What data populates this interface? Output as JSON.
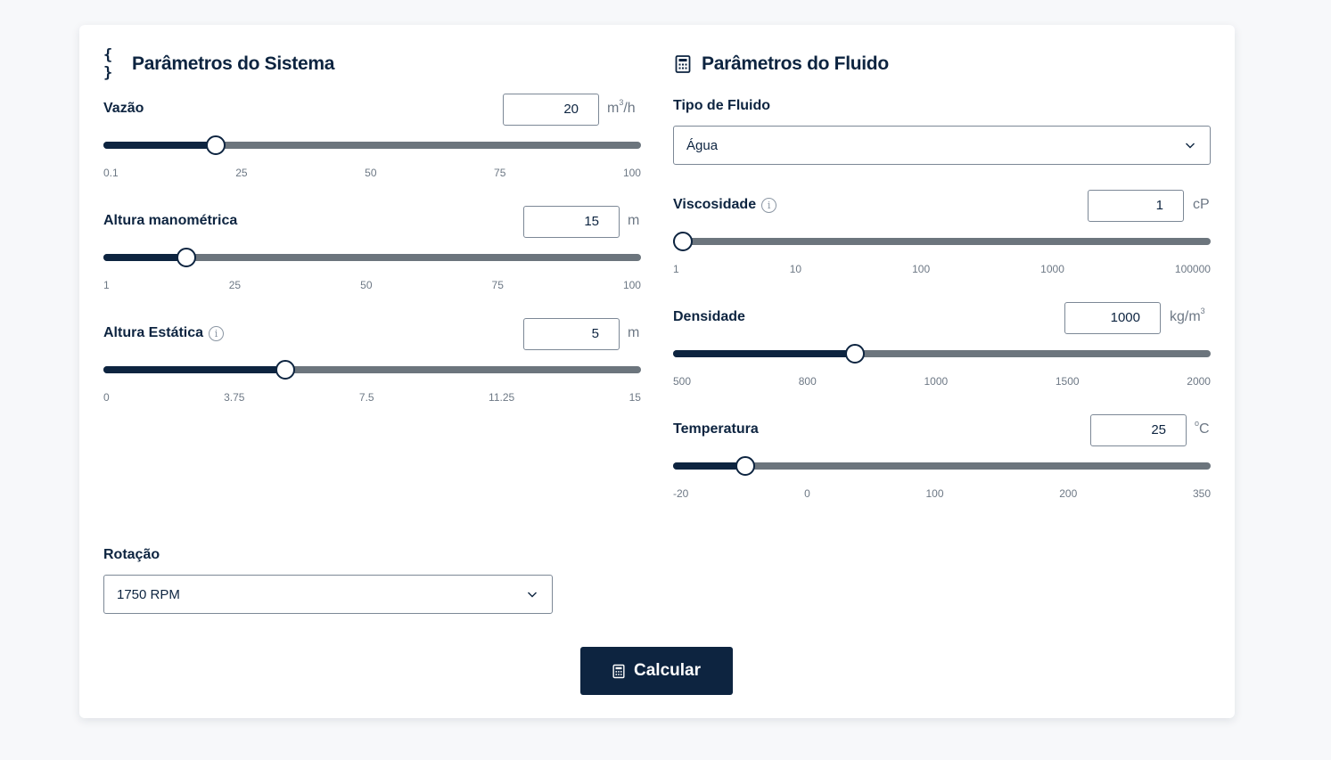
{
  "system": {
    "title": "Parâmetros do Sistema",
    "icon": "code-braces-icon",
    "fields": [
      {
        "label": "Vazão",
        "value": "20",
        "unit_base": "m",
        "unit_sup": "3",
        "unit_suffix": "/h",
        "ticks": [
          "0.1",
          "25",
          "50",
          "75",
          "100"
        ],
        "slider_fraction": 0.209,
        "info": false
      },
      {
        "label": "Altura manométrica",
        "value": "15",
        "unit_base": "m",
        "unit_sup": "",
        "unit_suffix": "",
        "ticks": [
          "1",
          "25",
          "50",
          "75",
          "100"
        ],
        "slider_fraction": 0.154,
        "info": false
      },
      {
        "label": "Altura Estática",
        "value": "5",
        "unit_base": "m",
        "unit_sup": "",
        "unit_suffix": "",
        "ticks": [
          "0",
          "3.75",
          "7.5",
          "11.25",
          "15"
        ],
        "slider_fraction": 0.338,
        "info": true
      }
    ],
    "rotation": {
      "label": "Rotação",
      "value": "1750 RPM"
    }
  },
  "fluid": {
    "title": "Parâmetros do Fluido",
    "icon": "calculator-icon",
    "type": {
      "label": "Tipo de Fluido",
      "value": "Água"
    },
    "fields": [
      {
        "label": "Viscosidade",
        "value": "1",
        "unit_base": "cP",
        "unit_sup": "",
        "unit_suffix": "",
        "ticks": [
          "1",
          "10",
          "100",
          "1000",
          "100000"
        ],
        "slider_fraction": 0.018,
        "info": true
      },
      {
        "label": "Densidade",
        "value": "1000",
        "unit_base": "kg/m",
        "unit_sup": "3",
        "unit_suffix": "",
        "ticks": [
          "500",
          "800",
          "1000",
          "1500",
          "2000"
        ],
        "slider_fraction": 0.339,
        "info": false
      },
      {
        "label": "Temperatura",
        "value": "25",
        "unit_base": "",
        "unit_sup": "o",
        "unit_suffix": "C",
        "ticks": [
          "-20",
          "0",
          "100",
          "200",
          "350"
        ],
        "slider_fraction": 0.135,
        "info": false
      }
    ]
  },
  "actions": {
    "calculate_label": "Calcular",
    "calculate_icon": "calculator-icon"
  },
  "colors": {
    "primary": "#0d2440",
    "track": "#6c757d",
    "muted": "#6d7885",
    "background": "#f7f8fa"
  }
}
